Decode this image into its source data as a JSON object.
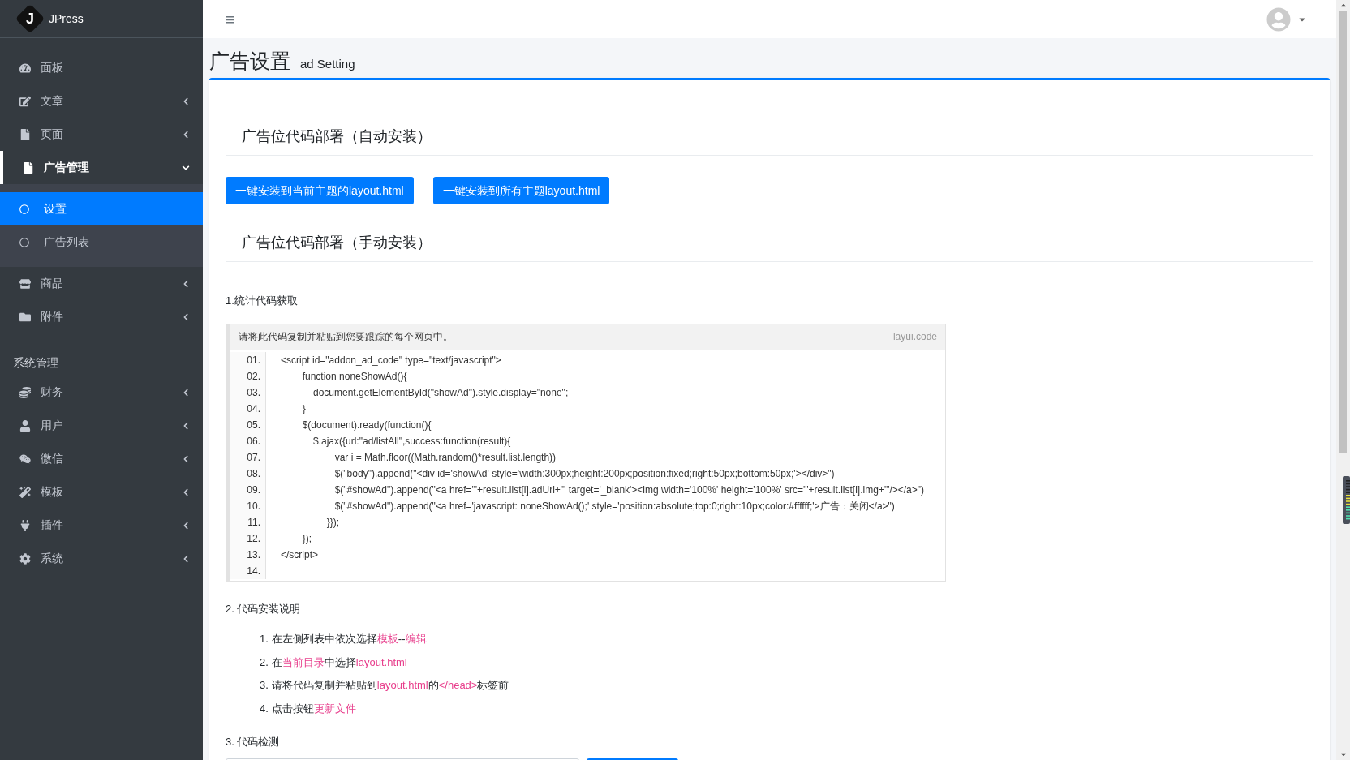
{
  "sidebar": {
    "brand": {
      "logo": "J",
      "name": "JPress"
    },
    "sections": [
      {
        "items": [
          {
            "label": "面板",
            "kind": "link",
            "selected": false
          },
          {
            "label": "文章",
            "kind": "group",
            "expanded": false,
            "selected": false
          },
          {
            "label": "页面",
            "kind": "group",
            "expanded": false,
            "selected": false
          },
          {
            "label": "广告管理",
            "kind": "group",
            "expanded": true,
            "selected": true,
            "children": [
              {
                "label": "设置",
                "selected": true
              },
              {
                "label": "广告列表",
                "selected": false
              }
            ]
          },
          {
            "label": "商品",
            "kind": "group",
            "expanded": false,
            "selected": false
          },
          {
            "label": "附件",
            "kind": "group",
            "expanded": false,
            "selected": false
          }
        ]
      },
      {
        "heading": "系统管理",
        "items": [
          {
            "label": "财务",
            "kind": "group",
            "expanded": false,
            "selected": false
          },
          {
            "label": "用户",
            "kind": "group",
            "expanded": false,
            "selected": false
          },
          {
            "label": "微信",
            "kind": "group",
            "expanded": false,
            "selected": false
          },
          {
            "label": "模板",
            "kind": "group",
            "expanded": false,
            "selected": false
          },
          {
            "label": "插件",
            "kind": "group",
            "expanded": false,
            "selected": false
          },
          {
            "label": "系统",
            "kind": "group",
            "expanded": false,
            "selected": false
          }
        ]
      }
    ]
  },
  "header": {
    "menu_glyph": "≡"
  },
  "page": {
    "title": "广告设置",
    "subtitle": "ad Setting"
  },
  "auto_install": {
    "heading": "广告位代码部署（自动安装）",
    "buttons": [
      "一键安装到当前主题的layout.html",
      "一键安装到所有主题layout.html"
    ]
  },
  "manual_install": {
    "heading": "广告位代码部署（手动安装）",
    "step1": {
      "title": "1.统计代码获取",
      "code_block": {
        "caption": "请将此代码复制并粘贴到您要跟踪的每个网页中。",
        "tag": "layui.code",
        "lines": [
          {
            "no": "01.",
            "code": "<script id=\"addon_ad_code\" type=\"text/javascript\">"
          },
          {
            "no": "02.",
            "code": "        function noneShowAd(){"
          },
          {
            "no": "03.",
            "code": "            document.getElementById(\"showAd\").style.display=\"none\";"
          },
          {
            "no": "04.",
            "code": "        }"
          },
          {
            "no": "05.",
            "code": "        $(document).ready(function(){"
          },
          {
            "no": "06.",
            "code": "            $.ajax({url:\"ad/listAll\",success:function(result){"
          },
          {
            "no": "07.",
            "code": "                    var i = Math.floor((Math.random()*result.list.length))"
          },
          {
            "no": "08.",
            "code": "                    $(\"body\").append(\"<div id='showAd' style='width:300px;height:200px;position:fixed;right:50px;bottom:50px;'></div>\")"
          },
          {
            "no": "09.",
            "code": "                    $(\"#showAd\").append(\"<a href='\"+result.list[i].adUrl+\"' target='_blank'><img width='100%' height='100%' src='\"+result.list[i].img+\"'/></a>\")"
          },
          {
            "no": "10.",
            "code": "                    $(\"#showAd\").append(\"<a href='javascript: noneShowAd();' style='position:absolute;top:0;right:10px;color:#ffffff;'>广告：关闭</a>\")"
          },
          {
            "no": "11.",
            "code": "                 }});"
          },
          {
            "no": "12.",
            "code": "        });"
          },
          {
            "no": "13.",
            "code": "</script>"
          },
          {
            "no": "14."
          }
        ]
      }
    },
    "step2": {
      "title": "2. 代码安装说明",
      "steps": [
        {
          "marker": "1.",
          "parts": [
            {
              "text": "在左侧列表中依次选择",
              "highlight": false
            },
            {
              "text": "模板",
              "highlight": true
            },
            {
              "text": "--",
              "highlight": false
            },
            {
              "text": "编辑",
              "highlight": true
            }
          ]
        },
        {
          "marker": "2.",
          "parts": [
            {
              "text": "在",
              "highlight": false
            },
            {
              "text": "当前目录",
              "highlight": true
            },
            {
              "text": "中选择",
              "highlight": false
            },
            {
              "text": "layout.html",
              "highlight": true
            }
          ]
        },
        {
          "marker": "3.",
          "parts": [
            {
              "text": "请将代码复制并粘贴到",
              "highlight": false
            },
            {
              "text": "layout.html",
              "highlight": true
            },
            {
              "text": "的",
              "highlight": false
            },
            {
              "text": "</head>",
              "highlight": true
            },
            {
              "text": "标签前",
              "highlight": false
            }
          ]
        },
        {
          "marker": "4.",
          "parts": [
            {
              "text": "点击按钮",
              "highlight": false
            },
            {
              "text": "更新文件",
              "highlight": true
            }
          ]
        }
      ]
    },
    "step3": {
      "title": "3. 代码检测"
    }
  }
}
